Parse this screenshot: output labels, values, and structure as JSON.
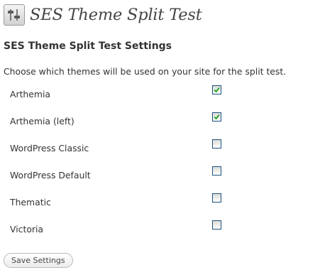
{
  "page": {
    "title": "SES Theme Split Test",
    "icon": "settings-sliders-icon"
  },
  "settings": {
    "heading": "SES Theme Split Test Settings",
    "description": "Choose which themes will be used on your site for the split test."
  },
  "themes": [
    {
      "label": "Arthemia",
      "checked": true
    },
    {
      "label": "Arthemia (left)",
      "checked": true
    },
    {
      "label": "WordPress Classic",
      "checked": false
    },
    {
      "label": "WordPress Default",
      "checked": false
    },
    {
      "label": "Thematic",
      "checked": false
    },
    {
      "label": "Victoria",
      "checked": false
    }
  ],
  "form": {
    "save_label": "Save Settings"
  },
  "colors": {
    "checkbox_border": "#1c5180",
    "checkmark": "#21a121"
  }
}
